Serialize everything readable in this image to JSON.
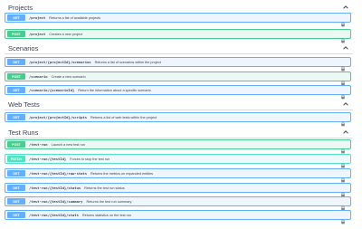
{
  "sections": [
    {
      "title": "Projects",
      "operations": [
        {
          "method": "GET",
          "path": "/project",
          "description": "Returns a list of available projects"
        },
        {
          "method": "POST",
          "path": "/project",
          "description": "Creates a new project"
        }
      ]
    },
    {
      "title": "Scenarios",
      "operations": [
        {
          "method": "GET",
          "path": "/project/{projectId}/scenarios",
          "description": "Returns a list of scenarios within the project"
        },
        {
          "method": "POST",
          "path": "/scenario",
          "description": "Create a new scenario"
        },
        {
          "method": "GET",
          "path": "/scenario/{scenarioId}",
          "description": "Return the information about a specific scenario"
        }
      ]
    },
    {
      "title": "Web Tests",
      "operations": [
        {
          "method": "GET",
          "path": "/project/{projectId}/scripts",
          "description": "Returns a list of web tests within the project"
        }
      ]
    },
    {
      "title": "Test Runs",
      "operations": [
        {
          "method": "POST",
          "path": "/test-run",
          "description": "Launch a new test run"
        },
        {
          "method": "PATCH",
          "path": "/test-run/{testId}",
          "description": "Forces to stop the test run"
        },
        {
          "method": "GET",
          "path": "/test-run/{testId}/raw-stats",
          "description": "Returns the metrics on expanded entities"
        },
        {
          "method": "GET",
          "path": "/test-run/{testId}/status",
          "description": "Returns the test run status"
        },
        {
          "method": "GET",
          "path": "/test-run/{testId}/summary",
          "description": "Returns the test run summary"
        },
        {
          "method": "GET",
          "path": "/test-run/{testId}/stats",
          "description": "Returns statistics on the test run"
        }
      ]
    }
  ],
  "icons": {
    "section_toggle": "chevron-up-icon",
    "operation_auth": "lock-icon"
  },
  "colors": {
    "get": "#61affe",
    "post": "#49cc90",
    "patch": "#50e3c2"
  }
}
